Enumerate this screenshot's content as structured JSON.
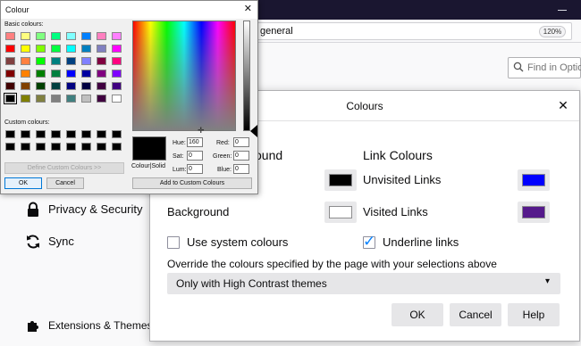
{
  "browser": {
    "url_text": "general",
    "zoom": "120%",
    "find_placeholder": "Find in Options"
  },
  "sidebar": {
    "items": [
      {
        "label": "Privacy & Security",
        "icon": "lock-icon"
      },
      {
        "label": "Sync",
        "icon": "sync-icon"
      },
      {
        "label": "Extensions & Themes",
        "icon": "puzzle-icon"
      }
    ]
  },
  "colours_dialog": {
    "title": "Colours",
    "close_glyph": "✕",
    "text_section_head_partial": "ound",
    "link_section_head": "Link Colours",
    "background_label": "Background",
    "unvisited_label": "Unvisited Links",
    "visited_label": "Visited Links",
    "use_system_label": "Use system colours",
    "underline_label": "Underline links",
    "override_label": "Override the colours specified by the page with your selections above",
    "override_value": "Only with High Contrast themes",
    "ok_label": "OK",
    "cancel_label": "Cancel",
    "help_label": "Help",
    "colors": {
      "text": "#000000",
      "background": "#ffffff",
      "unvisited": "#0000ff",
      "visited": "#551a8b"
    },
    "use_system_checked": false,
    "underline_checked": true
  },
  "colour_picker": {
    "title": "Colour",
    "close_glyph": "✕",
    "basic_label": "Basic colours:",
    "custom_label": "Custom colours:",
    "define_custom_label": "Define Custom Colours >>",
    "ok_label": "OK",
    "cancel_label": "Cancel",
    "add_custom_label": "Add to Custom Colours",
    "preview_label": "Colour|Solid",
    "hue_label": "Hue:",
    "sat_label": "Sat:",
    "lum_label": "Lum:",
    "red_label": "Red:",
    "green_label": "Green:",
    "blue_label": "Blue:",
    "hue": "160",
    "sat": "0",
    "lum": "0",
    "red": "0",
    "green": "0",
    "blue": "0",
    "basic_colours": [
      "#ff8080",
      "#ffff80",
      "#80ff80",
      "#00ff80",
      "#80ffff",
      "#0080ff",
      "#ff80c0",
      "#ff80ff",
      "#ff0000",
      "#ffff00",
      "#80ff00",
      "#00ff40",
      "#00ffff",
      "#0080c0",
      "#8080c0",
      "#ff00ff",
      "#804040",
      "#ff8040",
      "#00ff00",
      "#008080",
      "#004080",
      "#8080ff",
      "#800040",
      "#ff0080",
      "#800000",
      "#ff8000",
      "#008000",
      "#008040",
      "#0000ff",
      "#0000a0",
      "#800080",
      "#8000ff",
      "#400000",
      "#804000",
      "#004000",
      "#004040",
      "#000080",
      "#000040",
      "#400040",
      "#400080",
      "#000000",
      "#808000",
      "#808040",
      "#808080",
      "#408080",
      "#c0c0c0",
      "#400040",
      "#ffffff"
    ],
    "custom_colours": [
      "#000000",
      "#000000",
      "#000000",
      "#000000",
      "#000000",
      "#000000",
      "#000000",
      "#000000",
      "#000000",
      "#000000",
      "#000000",
      "#000000",
      "#000000",
      "#000000",
      "#000000",
      "#000000"
    ],
    "selected_basic_index": 40
  }
}
